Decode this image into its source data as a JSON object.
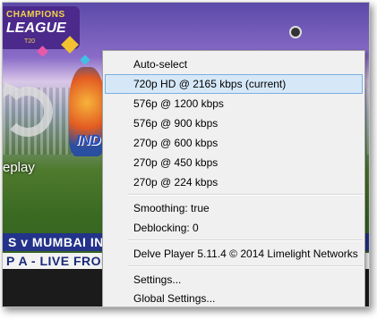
{
  "video": {
    "league_line1": "CHAMPIONS",
    "league_line2": "LEAGUE",
    "league_line3": "T20",
    "replay_label": "eplay",
    "team_text": "IND",
    "ticker_top": "S v MUMBAI IN",
    "ticker_bottom": "P A - LIVE FROM"
  },
  "menu": {
    "items": [
      {
        "label": "Auto-select"
      },
      {
        "label": "720p HD @ 2165 kbps (current)",
        "highlighted": true
      },
      {
        "label": "576p @ 1200 kbps"
      },
      {
        "label": "576p @ 900 kbps"
      },
      {
        "label": "270p @ 600 kbps"
      },
      {
        "label": "270p @ 450 kbps"
      },
      {
        "label": "270p @ 224 kbps"
      },
      {
        "label": "Smoothing: true"
      },
      {
        "label": "Deblocking: 0"
      },
      {
        "label": "Delve Player 5.11.4 © 2014 Limelight Networks"
      },
      {
        "label": "Settings..."
      },
      {
        "label": "Global Settings..."
      }
    ]
  },
  "colors": {
    "highlight_bg": "#d6e8f8",
    "highlight_border": "#78aee5",
    "menu_bg": "#f0f0f0"
  }
}
